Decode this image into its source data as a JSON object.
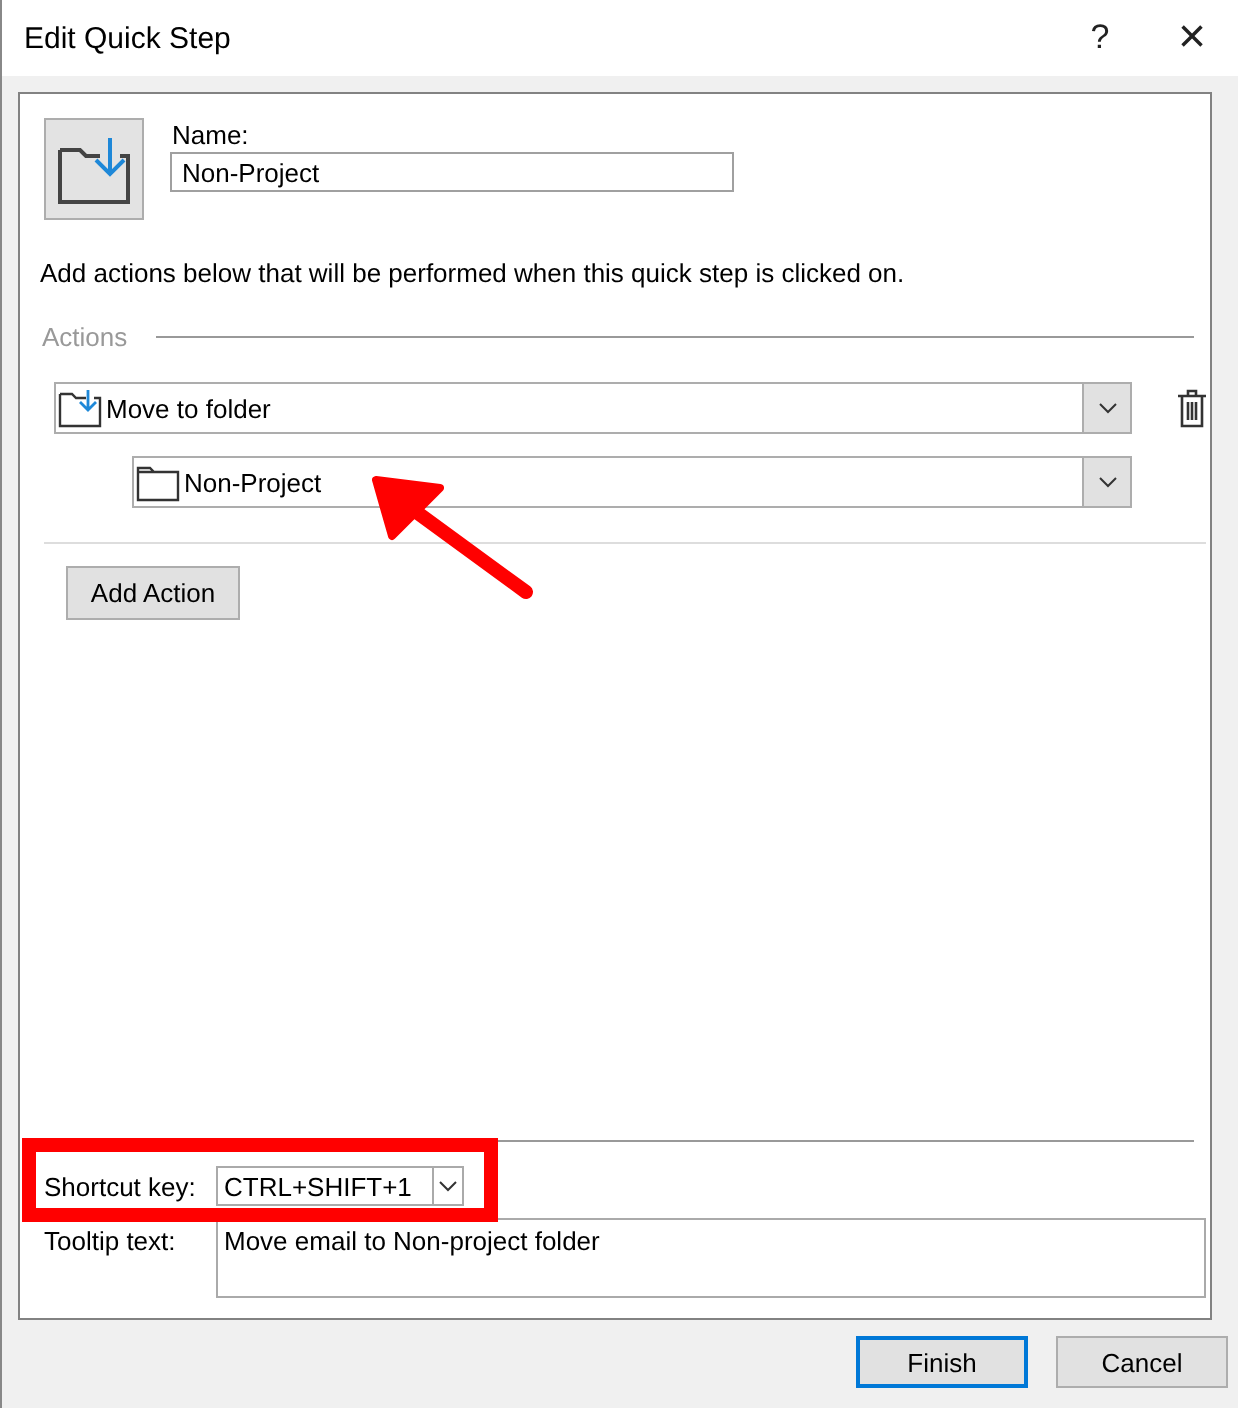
{
  "window": {
    "title": "Edit Quick Step",
    "help": "?",
    "close": "×"
  },
  "name_field": {
    "label": "Name:",
    "value": "Non-Project"
  },
  "description": "Add actions below that will be performed when this quick step is clicked on.",
  "actions_section": {
    "label": "Actions"
  },
  "actions": [
    {
      "kind": "move",
      "value": "Move to folder",
      "folder": "Non-Project"
    }
  ],
  "add_action_button": "Add Action",
  "optional_section": {
    "shortcut_label": "Shortcut key:",
    "shortcut_value": "CTRL+SHIFT+1",
    "tooltip_label": "Tooltip text:",
    "tooltip_value": "Move email to Non-project folder"
  },
  "buttons": [
    {
      "label": "Finish",
      "default": true
    },
    {
      "label": "Cancel",
      "default": false
    }
  ],
  "annotations": {
    "pointer_arrow": true,
    "highlight_frame": true
  }
}
